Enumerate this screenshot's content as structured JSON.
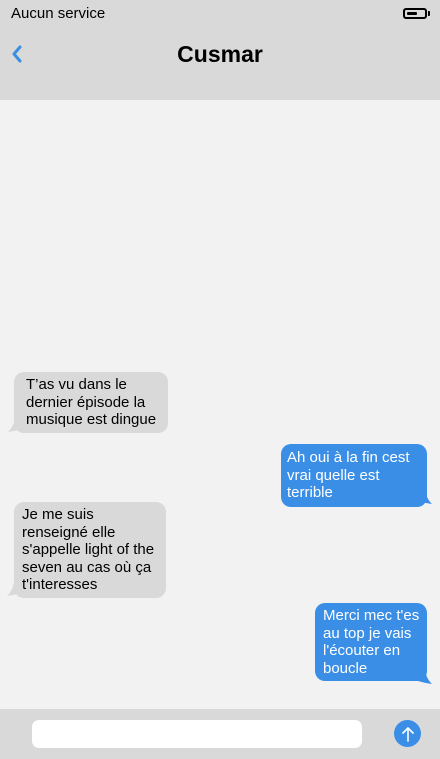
{
  "status_bar": {
    "carrier": "Aucun service",
    "battery_percent": 60
  },
  "header": {
    "title": "Cusmar",
    "back_icon": "chevron-left-icon"
  },
  "colors": {
    "accent": "#3a8ee6",
    "incoming_bubble": "#d9d9d9",
    "bar": "#d9d9d9",
    "background": "#f2f2f2"
  },
  "messages": [
    {
      "direction": "incoming",
      "text": "T’as vu dans le dernier épisode la musique est dingue"
    },
    {
      "direction": "outgoing",
      "text": "Ah oui à la fin cest vrai quelle est terrible"
    },
    {
      "direction": "incoming",
      "text": "Je me suis renseigné elle s'appelle light of the seven au cas où ça t'interesses"
    },
    {
      "direction": "outgoing",
      "text": "Merci mec t'es au top je vais l'écouter en boucle"
    }
  ],
  "composer": {
    "value": "",
    "placeholder": "",
    "send_icon": "arrow-up-icon"
  }
}
